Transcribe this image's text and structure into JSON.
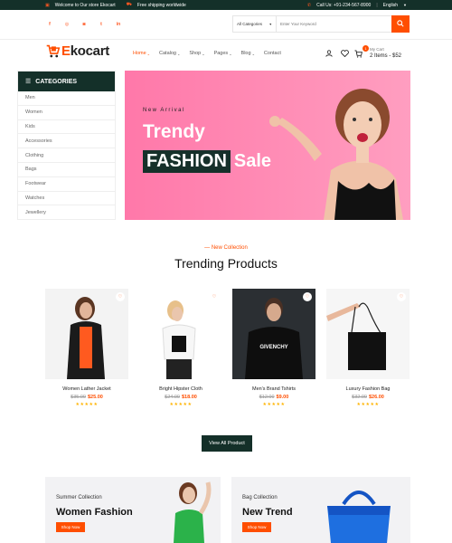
{
  "topbar": {
    "welcome": "Welcome to Our store Ekocart",
    "shipping": "Free shipping worldwide",
    "phone": "Call Us: +91-234-567-8900",
    "language": "English"
  },
  "search": {
    "category": "All Categories",
    "placeholder": "Enter Your Keyword"
  },
  "logo": {
    "first": "E",
    "rest": "kocart"
  },
  "menu": [
    "Home",
    "Catalog",
    "Shop",
    "Pages",
    "Blog",
    "Contact"
  ],
  "cart": {
    "label": "My Cart",
    "count": "1",
    "summary": "2 Items - $52"
  },
  "categories": {
    "title": "CATEGORIES",
    "items": [
      "Men",
      "Women",
      "Kids",
      "Accessories",
      "Clothing",
      "Bags",
      "Footwear",
      "Watches",
      "Jewellery"
    ]
  },
  "hero": {
    "sub": "New Arrival",
    "title": "Trendy",
    "fashion": "FASHION",
    "sale": "Sale"
  },
  "trending": {
    "tag": "— New Collection",
    "title": "Trending Products"
  },
  "products": [
    {
      "name": "Women Lather Jacket",
      "old": "$35.00",
      "new": "$25.00"
    },
    {
      "name": "Bright Hipster Cloth",
      "old": "$24.00",
      "new": "$18.00"
    },
    {
      "name": "Men's Brand Tshirts",
      "old": "$12.00",
      "new": "$9.00"
    },
    {
      "name": "Luxury Fashion Bag",
      "old": "$32.00",
      "new": "$26.00"
    }
  ],
  "rating": "★★★★★",
  "view_all": "View All Product",
  "banners": [
    {
      "sub": "Summer Collection",
      "title": "Women Fashion",
      "button": "Shop Now"
    },
    {
      "sub": "Bag Collection",
      "title": "New Trend",
      "button": "Shop Now"
    }
  ],
  "colors": {
    "accent": "#ff4e00",
    "dark": "#143029",
    "hero_pink": "#ff8ab5"
  }
}
